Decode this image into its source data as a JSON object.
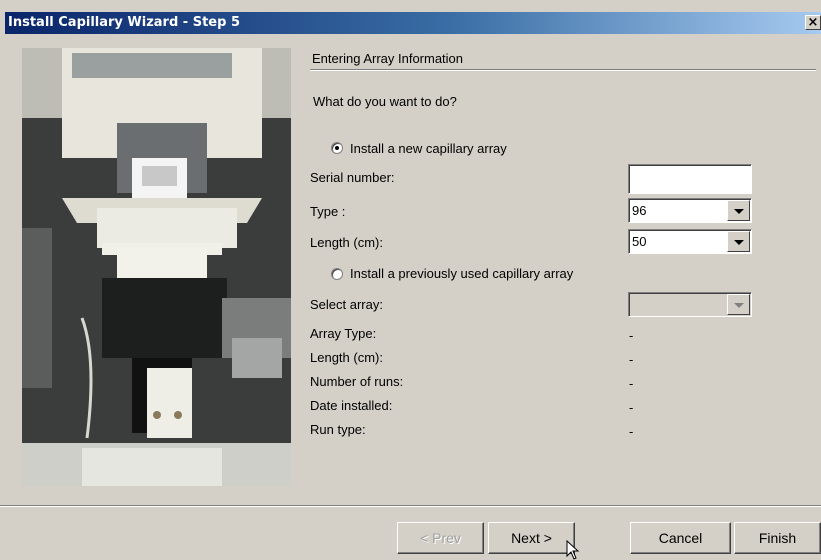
{
  "window": {
    "title": "Install Capillary Wizard - Step 5",
    "close_glyph": "×"
  },
  "section": {
    "title": "Entering Array Information"
  },
  "question": "What do you want to do?",
  "option_new": {
    "label": "Install a new capillary array",
    "selected": true
  },
  "fields": {
    "serial_number": {
      "label": "Serial number:",
      "value": ""
    },
    "type": {
      "label": "Type :",
      "value": "96"
    },
    "length": {
      "label": "Length (cm):",
      "value": "50"
    }
  },
  "option_used": {
    "label": "Install a previously used capillary array",
    "selected": false
  },
  "used": {
    "select_array": {
      "label": "Select array:",
      "value": ""
    },
    "rows": [
      {
        "label": "Array Type:",
        "value": "-"
      },
      {
        "label": "Length (cm):",
        "value": "-"
      },
      {
        "label": "Number of runs:",
        "value": "-"
      },
      {
        "label": "Date installed:",
        "value": "-"
      },
      {
        "label": "Run type:",
        "value": "-"
      }
    ]
  },
  "buttons": {
    "prev": "< Prev",
    "next": "Next >",
    "cancel": "Cancel",
    "finish": "Finish"
  }
}
